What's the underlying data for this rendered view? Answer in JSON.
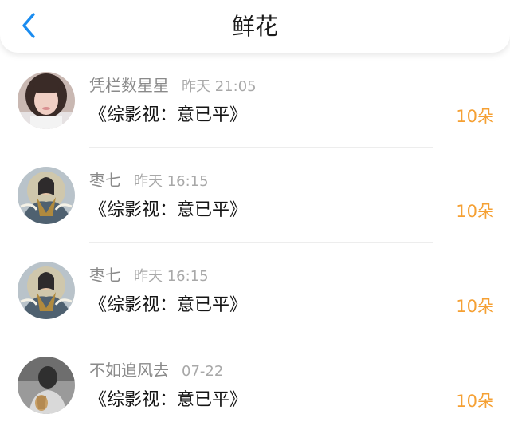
{
  "header": {
    "title": "鲜花",
    "back_icon": "chevron-left-icon",
    "accent_color": "#1a8cf0"
  },
  "list": {
    "items": [
      {
        "user": "凭栏数星星",
        "time": "昨天 21:05",
        "book": "《综影视：意已平》",
        "count": "10朵",
        "avatar": "photo-avatar-girl"
      },
      {
        "user": "枣七",
        "time": "昨天 16:15",
        "book": "《综影视：意已平》",
        "count": "10朵",
        "avatar": "illustration-avatar"
      },
      {
        "user": "枣七",
        "time": "昨天 16:15",
        "book": "《综影视：意已平》",
        "count": "10朵",
        "avatar": "illustration-avatar"
      },
      {
        "user": "不如追风去",
        "time": "07-22",
        "book": "《综影视：意已平》",
        "count": "10朵",
        "avatar": "photo-avatar-bw"
      }
    ]
  },
  "colors": {
    "count": "#f5a033",
    "meta": "#8c8c8c",
    "text": "#151515"
  }
}
